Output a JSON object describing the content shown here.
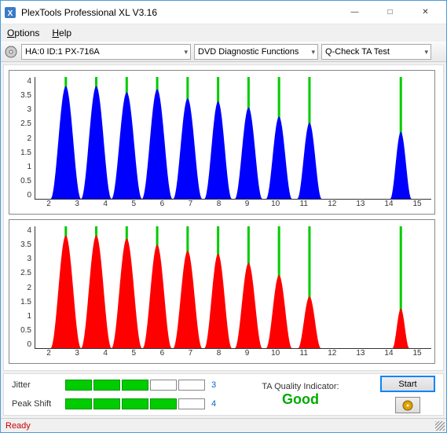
{
  "window": {
    "title": "PlexTools Professional XL V3.16",
    "min": "—",
    "max": "□",
    "close": "✕"
  },
  "menu": {
    "options": "Options",
    "help": "Help"
  },
  "toolbar": {
    "device": "HA:0 ID:1   PX-716A",
    "category": "DVD Diagnostic Functions",
    "test": "Q-Check TA Test"
  },
  "chart_data": [
    {
      "type": "area",
      "color": "#0000ff",
      "xlabel": "",
      "ylabel": "",
      "xlim": [
        2,
        15
      ],
      "ylim": [
        0,
        4
      ],
      "yticks": [
        0,
        0.5,
        1,
        1.5,
        2,
        2.5,
        3,
        3.5,
        4
      ],
      "xticks": [
        2,
        3,
        4,
        5,
        6,
        7,
        8,
        9,
        10,
        11,
        12,
        13,
        14,
        15
      ],
      "grid_x": [
        3,
        4,
        5,
        6,
        7,
        8,
        9,
        10,
        11,
        14
      ],
      "peaks": [
        {
          "center": 3.0,
          "height": 3.7,
          "width": 1.0
        },
        {
          "center": 4.0,
          "height": 3.7,
          "width": 1.0
        },
        {
          "center": 5.0,
          "height": 3.5,
          "width": 1.0
        },
        {
          "center": 6.0,
          "height": 3.6,
          "width": 1.0
        },
        {
          "center": 7.0,
          "height": 3.3,
          "width": 0.95
        },
        {
          "center": 8.0,
          "height": 3.2,
          "width": 0.9
        },
        {
          "center": 9.0,
          "height": 3.0,
          "width": 0.9
        },
        {
          "center": 10.0,
          "height": 2.7,
          "width": 0.85
        },
        {
          "center": 11.0,
          "height": 2.5,
          "width": 0.8
        },
        {
          "center": 14.0,
          "height": 2.2,
          "width": 0.7
        }
      ]
    },
    {
      "type": "area",
      "color": "#ff0000",
      "xlabel": "",
      "ylabel": "",
      "xlim": [
        2,
        15
      ],
      "ylim": [
        0,
        4
      ],
      "yticks": [
        0,
        0.5,
        1,
        1.5,
        2,
        2.5,
        3,
        3.5,
        4
      ],
      "xticks": [
        2,
        3,
        4,
        5,
        6,
        7,
        8,
        9,
        10,
        11,
        12,
        13,
        14,
        15
      ],
      "grid_x": [
        3,
        4,
        5,
        6,
        7,
        8,
        9,
        10,
        11,
        14
      ],
      "peaks": [
        {
          "center": 3.0,
          "height": 3.7,
          "width": 1.0
        },
        {
          "center": 4.0,
          "height": 3.7,
          "width": 1.0
        },
        {
          "center": 5.0,
          "height": 3.6,
          "width": 1.0
        },
        {
          "center": 6.0,
          "height": 3.4,
          "width": 0.95
        },
        {
          "center": 7.0,
          "height": 3.2,
          "width": 0.95
        },
        {
          "center": 8.0,
          "height": 3.1,
          "width": 0.9
        },
        {
          "center": 9.0,
          "height": 2.8,
          "width": 0.9
        },
        {
          "center": 10.0,
          "height": 2.4,
          "width": 0.85
        },
        {
          "center": 11.0,
          "height": 1.7,
          "width": 0.75
        },
        {
          "center": 14.0,
          "height": 1.3,
          "width": 0.55
        }
      ]
    }
  ],
  "metrics": {
    "jitter": {
      "label": "Jitter",
      "value": "3",
      "filled": 3,
      "total": 5
    },
    "peakshift": {
      "label": "Peak Shift",
      "value": "4",
      "filled": 4,
      "total": 5
    }
  },
  "ta": {
    "label": "TA Quality Indicator:",
    "value": "Good"
  },
  "buttons": {
    "start": "Start"
  },
  "status": {
    "text": "Ready"
  }
}
